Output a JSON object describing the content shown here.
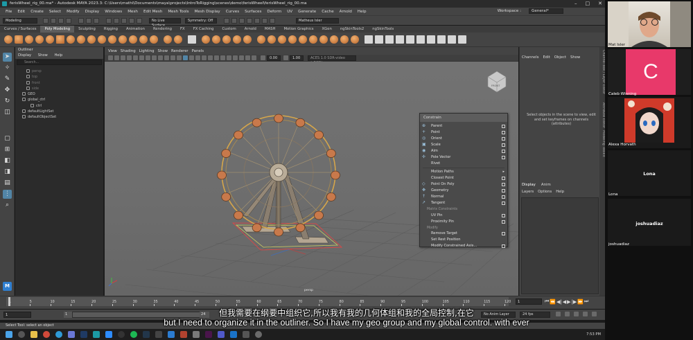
{
  "window": {
    "title": "ferisWheel_rig_00.ma* - Autodesk MAYA 2023.3: C:\\Users\\mathi\\Documents\\maya\\projects\\IntroToRigging\\scenes\\demo\\ferisWheel\\ferisWheel_rig_00.ma",
    "controls": [
      "–",
      "□",
      "✕"
    ]
  },
  "menubar": {
    "items": [
      "File",
      "Edit",
      "Create",
      "Select",
      "Modify",
      "Display",
      "Windows",
      "Mesh",
      "Edit Mesh",
      "Mesh Tools",
      "Mesh Display",
      "Curves",
      "Surfaces",
      "Deform",
      "UV",
      "Generate",
      "Cache",
      "Arnold",
      "Help"
    ],
    "workspace_label": "Workspace :",
    "workspace_value": "General*"
  },
  "statusline": {
    "menu_set": "Modeling",
    "live_surface": "No Live Surface",
    "symmetry": "Symmetry: Off",
    "user": "Matheus Isler"
  },
  "shelf": {
    "tabs": [
      "Curves / Surfaces",
      "Poly Modeling",
      "Sculpting",
      "Rigging",
      "Animation",
      "Rendering",
      "FX",
      "FX Caching",
      "Custom",
      "Arnold",
      "MASH",
      "Motion Graphics",
      "XGen",
      "ngSkinTools2",
      "ngSkinTools"
    ],
    "active_tab": "Poly Modeling"
  },
  "outliner": {
    "title": "Outliner",
    "menu": [
      "Display",
      "Show",
      "Help"
    ],
    "search_placeholder": "Search...",
    "items": [
      {
        "label": "persp",
        "dim": true,
        "indent": 1
      },
      {
        "label": "top",
        "dim": true,
        "indent": 1
      },
      {
        "label": "front",
        "dim": true,
        "indent": 1
      },
      {
        "label": "side",
        "dim": true,
        "indent": 1
      },
      {
        "label": "GEO",
        "dim": false,
        "indent": 0
      },
      {
        "label": "global_ctrl",
        "dim": false,
        "indent": 0
      },
      {
        "label": "ctrl",
        "dim": false,
        "indent": 2
      },
      {
        "label": "defaultLightSet",
        "dim": false,
        "indent": 0
      },
      {
        "label": "defaultObjectSet",
        "dim": false,
        "indent": 0
      }
    ]
  },
  "viewport": {
    "menu": [
      "View",
      "Shading",
      "Lighting",
      "Show",
      "Renderer",
      "Panels"
    ],
    "field_a": "0.00",
    "field_b": "1.00",
    "color_space": "ACES 1.0 SDR-video (sRGB)",
    "camera_label": "persp",
    "viewcube_label": "FRONT"
  },
  "constrain_menu": {
    "title": "Constrain",
    "items": [
      {
        "label": "Parent",
        "opt": true
      },
      {
        "label": "Point",
        "opt": true
      },
      {
        "label": "Orient",
        "opt": true
      },
      {
        "label": "Scale",
        "opt": true
      },
      {
        "label": "Aim",
        "opt": true
      },
      {
        "label": "Pole Vector",
        "opt": true
      },
      {
        "label": "Rivet",
        "opt": false
      },
      {
        "sep": true
      },
      {
        "label": "Motion Paths",
        "submenu": true
      },
      {
        "label": "Closest Point",
        "opt": true
      },
      {
        "label": "Point On Poly",
        "opt": true
      },
      {
        "label": "Geometry",
        "opt": true
      },
      {
        "label": "Normal",
        "opt": true
      },
      {
        "label": "Tangent",
        "opt": true
      },
      {
        "section": "Matrix Constraints"
      },
      {
        "label": "UV Pin",
        "opt": true
      },
      {
        "label": "Proximity Pin",
        "opt": true
      },
      {
        "section": "Modify"
      },
      {
        "label": "Remove Target",
        "opt": true
      },
      {
        "label": "Set Rest Position",
        "opt": false
      },
      {
        "label": "Modify Constrained Axis...",
        "opt": true
      }
    ]
  },
  "channelbox": {
    "menu": [
      "Channels",
      "Edit",
      "Object",
      "Show"
    ],
    "message": "Select objects in the scene to view, edit and set keyframes on channels (attributes)"
  },
  "layers": {
    "tabs": [
      "Display",
      "Anim"
    ],
    "active_tab": "Display",
    "menu": [
      "Layers",
      "Options",
      "Help"
    ]
  },
  "side_tabs": [
    "Channel Box / Layer Editor",
    "Attribute Editor",
    "Modeling Toolkit"
  ],
  "timeline": {
    "ticks": [
      "1",
      "5",
      "10",
      "15",
      "20",
      "25",
      "30",
      "35",
      "40",
      "45",
      "50",
      "55",
      "60",
      "65",
      "70",
      "75",
      "80",
      "85",
      "90",
      "95",
      "100",
      "105",
      "110",
      "115",
      "120"
    ],
    "current_frame": "1",
    "range_start": "1",
    "range_inner_start": "1",
    "range_end_field": "24",
    "anim_layer": "No Anim Layer",
    "fps": "24 fps"
  },
  "helpline": {
    "text": "Select Tool: select an object"
  },
  "taskbar": {
    "time": "7:53 PM"
  },
  "subtitles": {
    "chinese": "但我需要在纲要中组织它,所以我有我的几何体组和我的全局控制,在它",
    "english": "but I need to organize it in the outliner. So I have my geo group and my global control. with ever"
  },
  "video_call": {
    "participants": [
      {
        "name": "Mat Isler",
        "kind": "camera"
      },
      {
        "name": "Caleb Winning",
        "initial": "C",
        "color": "#e8396a"
      },
      {
        "name": "Alexa Horvath",
        "kind": "avatar"
      },
      {
        "name": "Lona",
        "label": "Lona"
      },
      {
        "name": "joshuadiaz",
        "label": "joshuadiaz"
      }
    ]
  },
  "colors": {
    "maya_panel": "#444444",
    "viewport_bg": "#707070",
    "selection_blue": "#5285a6",
    "caleb_tile": "#e8396a",
    "wheel_gold": "#d6a64a",
    "cabin_orange": "#c8794b"
  }
}
